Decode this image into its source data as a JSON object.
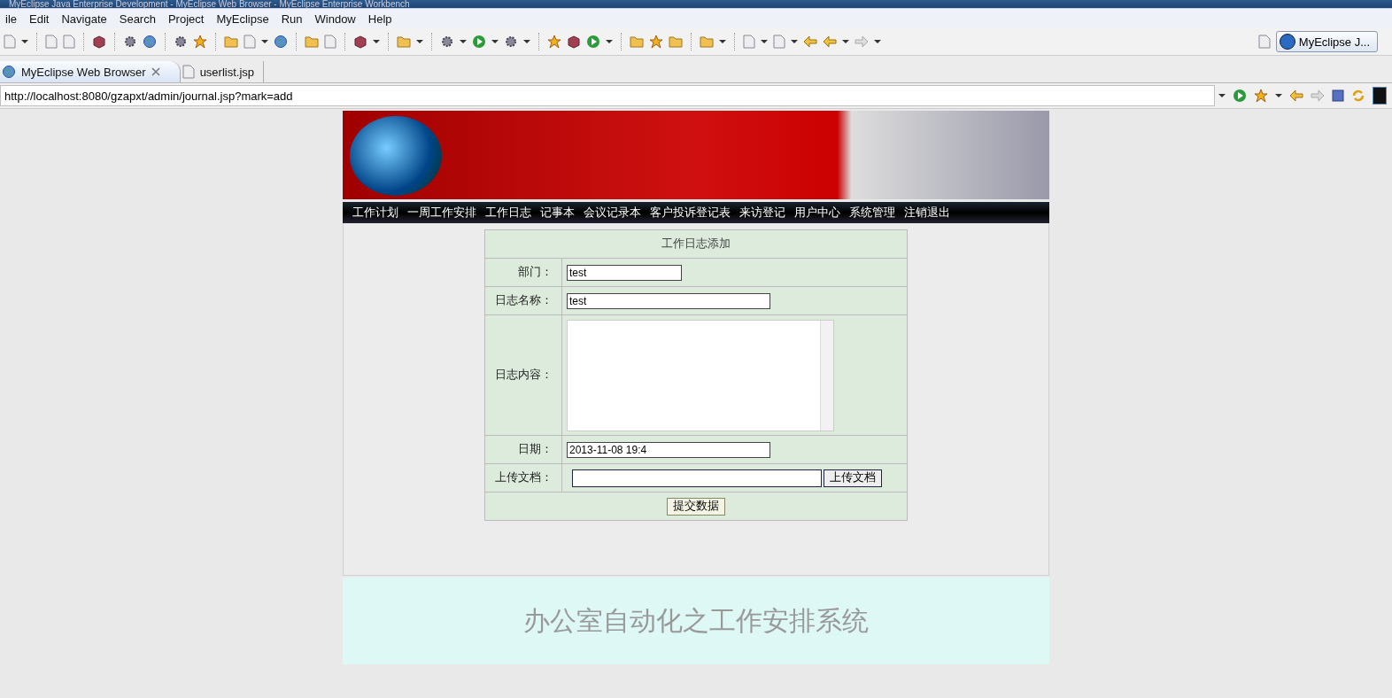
{
  "window": {
    "title": "MyEclipse Java Enterprise Development - MyEclipse Web Browser - MyEclipse Enterprise Workbench"
  },
  "menu": [
    "ile",
    "Edit",
    "Navigate",
    "Search",
    "Project",
    "MyEclipse",
    "Run",
    "Window",
    "Help"
  ],
  "perspective": {
    "label": "MyEclipse J..."
  },
  "tabs": [
    {
      "label": "MyEclipse Web Browser",
      "selected": true
    },
    {
      "label": "userlist.jsp",
      "selected": false
    }
  ],
  "address": {
    "value": "http://localhost:8080/gzapxt/admin/journal.jsp?mark=add"
  },
  "page": {
    "nav": [
      "工作计划",
      "一周工作安排",
      "工作日志",
      "记事本",
      "会议记录本",
      "客户投诉登记表",
      "来访登记",
      "用户中心",
      "系统管理",
      "注销退出"
    ],
    "form": {
      "title": "工作日志添加",
      "fields": [
        {
          "kind": "text",
          "label": "部门：",
          "value": "test"
        },
        {
          "kind": "text",
          "label": "日志名称：",
          "value": "test"
        },
        {
          "kind": "textarea",
          "label": "日志内容："
        },
        {
          "kind": "text",
          "label": "日期：",
          "value": "2013-11-08 19:4"
        },
        {
          "kind": "file",
          "label": "上传文档：",
          "button": "上传文档"
        }
      ],
      "submit": "提交数据"
    },
    "footer": "办公室自动化之工作安排系统"
  }
}
